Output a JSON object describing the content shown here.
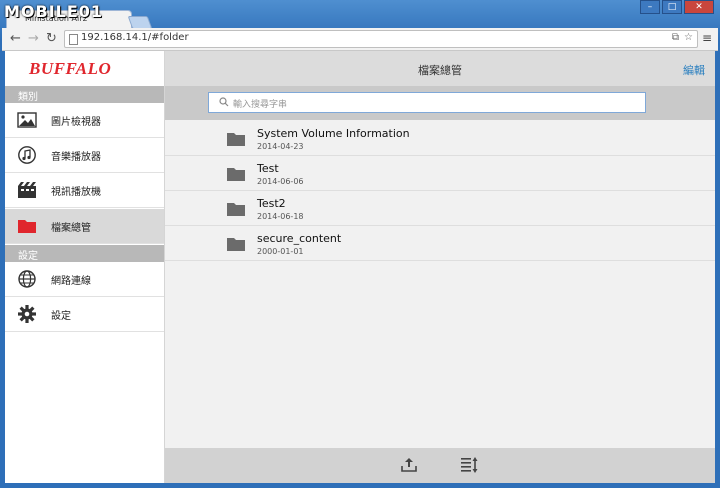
{
  "browser": {
    "watermark": "MOBILE01",
    "tab_title": "Ministation Air2",
    "url": "192.168.14.1/#folder",
    "window_controls": [
      "–",
      "□",
      "✕"
    ],
    "menu_icon": "hamburger-icon"
  },
  "app": {
    "logo": "BUFFALO",
    "brand_color": "#e0262d",
    "accent_color": "#2a7fbf"
  },
  "sidebar": {
    "sections": [
      {
        "title": "類別",
        "items": [
          {
            "label": "圖片檢視器",
            "icon": "image-icon"
          },
          {
            "label": "音樂播放器",
            "icon": "music-icon"
          },
          {
            "label": "視訊播放機",
            "icon": "film-icon"
          },
          {
            "label": "檔案總管",
            "icon": "folder-icon",
            "active": true
          }
        ]
      },
      {
        "title": "設定",
        "items": [
          {
            "label": "網路連線",
            "icon": "globe-icon"
          },
          {
            "label": "設定",
            "icon": "gear-icon"
          }
        ]
      }
    ]
  },
  "main": {
    "title": "檔案總管",
    "edit_label": "編輯",
    "search_placeholder": "輸入搜尋字串",
    "files": [
      {
        "name": "System Volume Information",
        "date": "2014-04-23"
      },
      {
        "name": "Test",
        "date": "2014-06-06"
      },
      {
        "name": "Test2",
        "date": "2014-06-18"
      },
      {
        "name": "secure_content",
        "date": "2000-01-01"
      }
    ],
    "bottom_buttons": [
      "upload-icon",
      "sort-icon"
    ]
  }
}
